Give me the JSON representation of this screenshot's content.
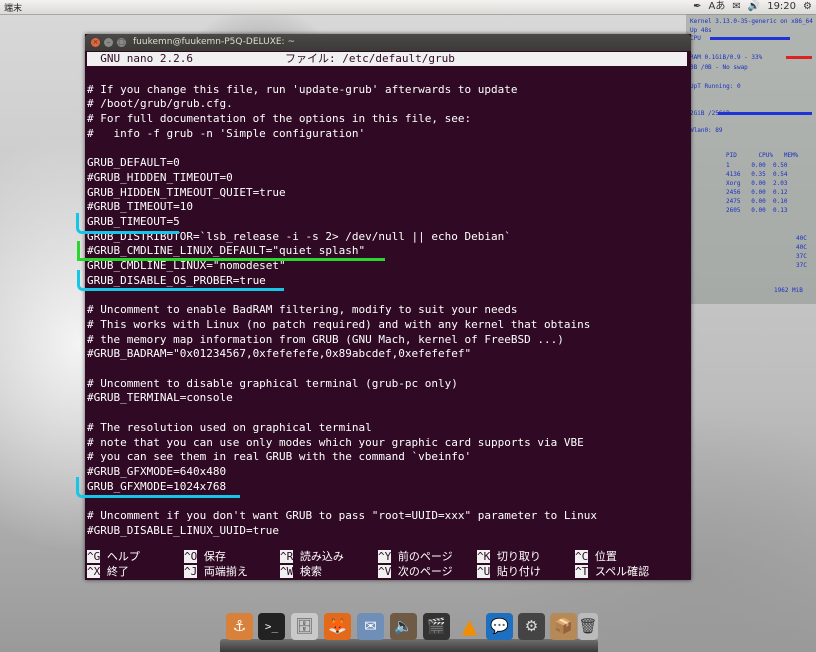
{
  "top_panel": {
    "left_label": "端末",
    "clock": "19:20",
    "tray_icons": [
      "pen-icon",
      "keyboard-layout-icon",
      "mail-icon",
      "volume-icon",
      "settings-gear-icon"
    ],
    "keyboard_label": "Aあ"
  },
  "conky": {
    "kernel": "Kernel 3.13.0-35-generic on x86_64",
    "uptime": "Up 48s",
    "cpu_label": "CPU",
    "mem_line": "RAM 0.1GiB/0.9 - 33%",
    "swap_line": "0B /0B  - No swap",
    "procs": "UpT Running: 0",
    "disk": "2GiB /25GiB",
    "net": "Wlan0: 89",
    "proc_header": [
      "PID",
      "CPU%",
      "MEM%"
    ],
    "proc_rows": [
      [
        "1",
        "0.00",
        "0.50"
      ],
      [
        "4136",
        "0.35",
        "0.54"
      ],
      [
        "Xorg",
        "0.00",
        "2.03"
      ],
      [
        "2456",
        "0.00",
        "0.12"
      ],
      [
        "2475",
        "0.00",
        "0.10"
      ],
      [
        "2605",
        "0.00",
        "0.13"
      ]
    ],
    "temps": [
      "40C",
      "40C",
      "37C",
      "37C"
    ],
    "bottom": "1962 MiB"
  },
  "window": {
    "title": "fuukemn@fuukemn-P5Q-DELUXE: ~",
    "header_left": "  GNU nano 2.2.6",
    "header_center": "ファイル: /etc/default/grub"
  },
  "file_lines": [
    "",
    "# If you change this file, run 'update-grub' afterwards to update",
    "# /boot/grub/grub.cfg.",
    "# For full documentation of the options in this file, see:",
    "#   info -f grub -n 'Simple configuration'",
    "",
    "GRUB_DEFAULT=0",
    "#GRUB_HIDDEN_TIMEOUT=0",
    "GRUB_HIDDEN_TIMEOUT_QUIET=true",
    "#GRUB_TIMEOUT=10",
    "GRUB_TIMEOUT=5",
    "GRUB_DISTRIBUTOR=`lsb_release -i -s 2> /dev/null || echo Debian`",
    "#GRUB_CMDLINE_LINUX_DEFAULT=\"quiet splash\"",
    "GRUB_CMDLINE_LINUX=\"nomodeset\"",
    "GRUB_DISABLE_OS_PROBER=true",
    "",
    "# Uncomment to enable BadRAM filtering, modify to suit your needs",
    "# This works with Linux (no patch required) and with any kernel that obtains",
    "# the memory map information from GRUB (GNU Mach, kernel of FreeBSD ...)",
    "#GRUB_BADRAM=\"0x01234567,0xfefefefe,0x89abcdef,0xefefefef\"",
    "",
    "# Uncomment to disable graphical terminal (grub-pc only)",
    "#GRUB_TERMINAL=console",
    "",
    "# The resolution used on graphical terminal",
    "# note that you can use only modes which your graphic card supports via VBE",
    "# you can see them in real GRUB with the command `vbeinfo'",
    "#GRUB_GFXMODE=640x480",
    "GRUB_GFXMODE=1024x768",
    "",
    "# Uncomment if you don't want GRUB to pass \"root=UUID=xxx\" parameter to Linux",
    "#GRUB_DISABLE_LINUX_UUID=true"
  ],
  "shortcuts_row1": [
    {
      "key": "^G",
      "label": "ヘルプ"
    },
    {
      "key": "^O",
      "label": "保存"
    },
    {
      "key": "^R",
      "label": "読み込み"
    },
    {
      "key": "^Y",
      "label": "前のページ"
    },
    {
      "key": "^K",
      "label": "切り取り"
    },
    {
      "key": "^C",
      "label": "位置"
    }
  ],
  "shortcuts_row2": [
    {
      "key": "^X",
      "label": "終了"
    },
    {
      "key": "^J",
      "label": "両端揃え"
    },
    {
      "key": "^W",
      "label": "検索"
    },
    {
      "key": "^V",
      "label": "次のページ"
    },
    {
      "key": "^U",
      "label": "貼り付け"
    },
    {
      "key": "^T",
      "label": "スペル確認"
    }
  ],
  "dock_icons": [
    "anchor-icon",
    "terminal-icon",
    "files-icon",
    "firefox-icon",
    "mail-client-icon",
    "speaker-icon",
    "film-clapper-icon",
    "vlc-cone-icon",
    "chat-icon",
    "settings-icon",
    "archive-icon",
    "trash-icon"
  ],
  "colors": {
    "terminal_bg": "#300a24",
    "highlight_cyan": "#16c6e6",
    "highlight_green": "#2bd52b"
  }
}
